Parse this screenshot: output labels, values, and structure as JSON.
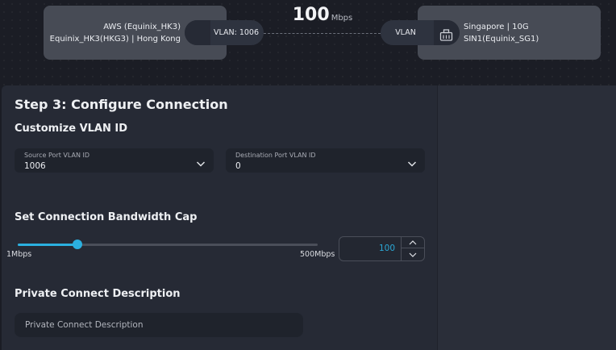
{
  "connection": {
    "source": {
      "line1": "AWS (Equinix_HK3)",
      "line2": "Equinix_HK3(HKG3) | Hong Kong",
      "vlan_pill": "VLAN: 1006"
    },
    "destination": {
      "line1": "Singapore | 10G",
      "line2": "SIN1(Equinix_SG1)",
      "vlan_pill": "VLAN",
      "icon": "building-icon"
    },
    "bandwidth": {
      "value": "100",
      "unit": "Mbps"
    }
  },
  "form": {
    "step_title": "Step 3: Configure Connection",
    "vlan_section": {
      "title": "Customize VLAN ID",
      "source": {
        "label": "Source Port VLAN ID",
        "value": "1006"
      },
      "destination": {
        "label": "Destination Port VLAN ID",
        "value": "0"
      }
    },
    "bandwidth_section": {
      "title": "Set Connection Bandwidth Cap",
      "min_label": "1Mbps",
      "max_label": "500Mbps",
      "slider_fraction": 0.2,
      "value": "100"
    },
    "description_section": {
      "title": "Private Connect Description",
      "placeholder": "Private Connect Description"
    }
  },
  "colors": {
    "accent": "#2bb0e0",
    "background": "#1b1d25",
    "panel": "#262a35",
    "endpoint_card": "#474b55"
  }
}
